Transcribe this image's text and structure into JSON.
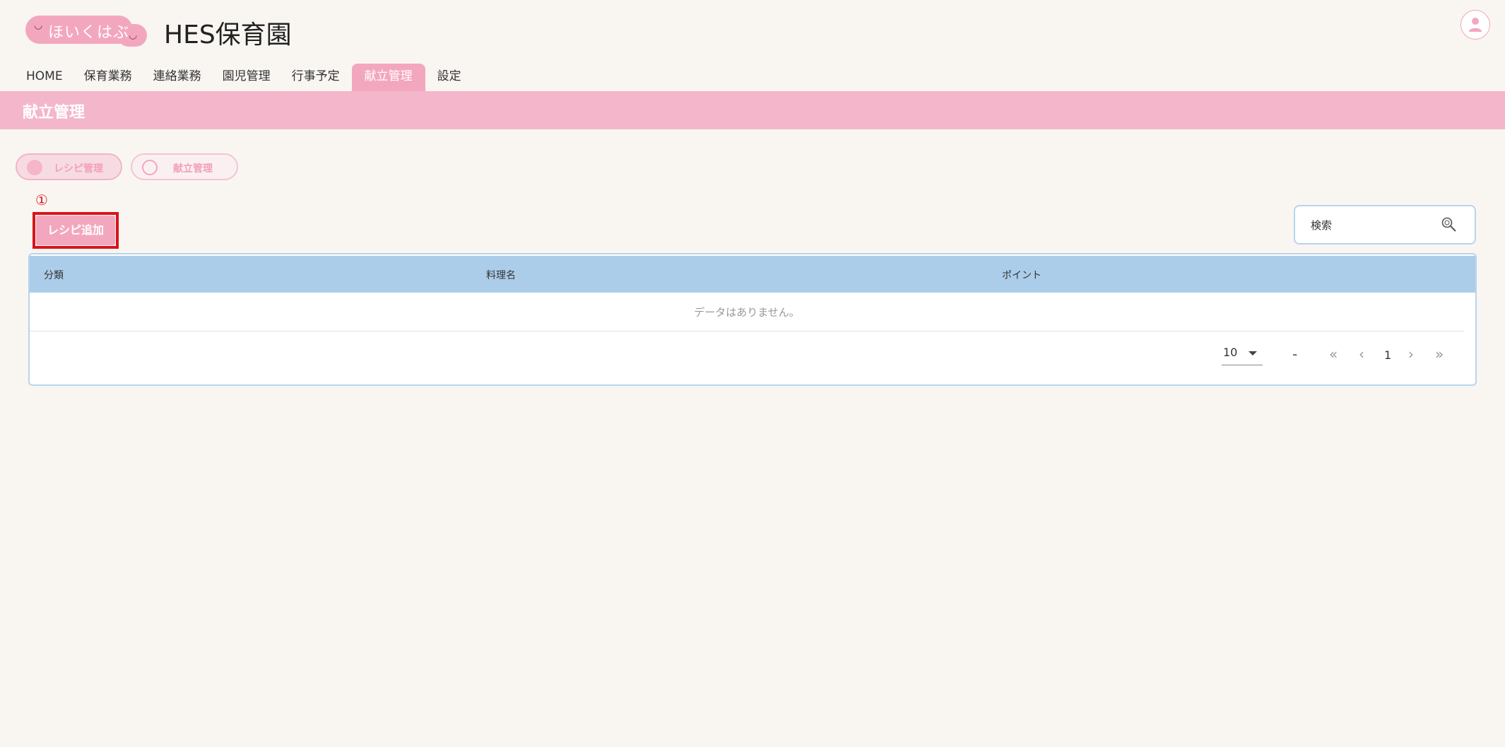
{
  "header": {
    "logo_text": "ほいくはぶ",
    "app_title": "HES保育園"
  },
  "nav": {
    "tabs": [
      {
        "label": "HOME"
      },
      {
        "label": "保育業務"
      },
      {
        "label": "連絡業務"
      },
      {
        "label": "園児管理"
      },
      {
        "label": "行事予定"
      },
      {
        "label": "献立管理",
        "active": true
      },
      {
        "label": "設定"
      }
    ]
  },
  "page": {
    "title": "献立管理"
  },
  "subtabs": {
    "recipe": "レシピ管理",
    "menu": "献立管理"
  },
  "annotation": {
    "number": "①"
  },
  "actions": {
    "add_recipe": "レシピ追加"
  },
  "search": {
    "placeholder": "検索"
  },
  "table": {
    "columns": [
      "分類",
      "料理名",
      "ポイント"
    ],
    "empty_text": "データはありません。"
  },
  "pagination": {
    "per_page": "10",
    "range": "-",
    "current_page": "1"
  },
  "colors": {
    "accent": "#f3a7be",
    "title_bar": "#f4b6cb",
    "table_header": "#accde9",
    "annotation": "#d8141b",
    "background": "#f9f6f2"
  }
}
